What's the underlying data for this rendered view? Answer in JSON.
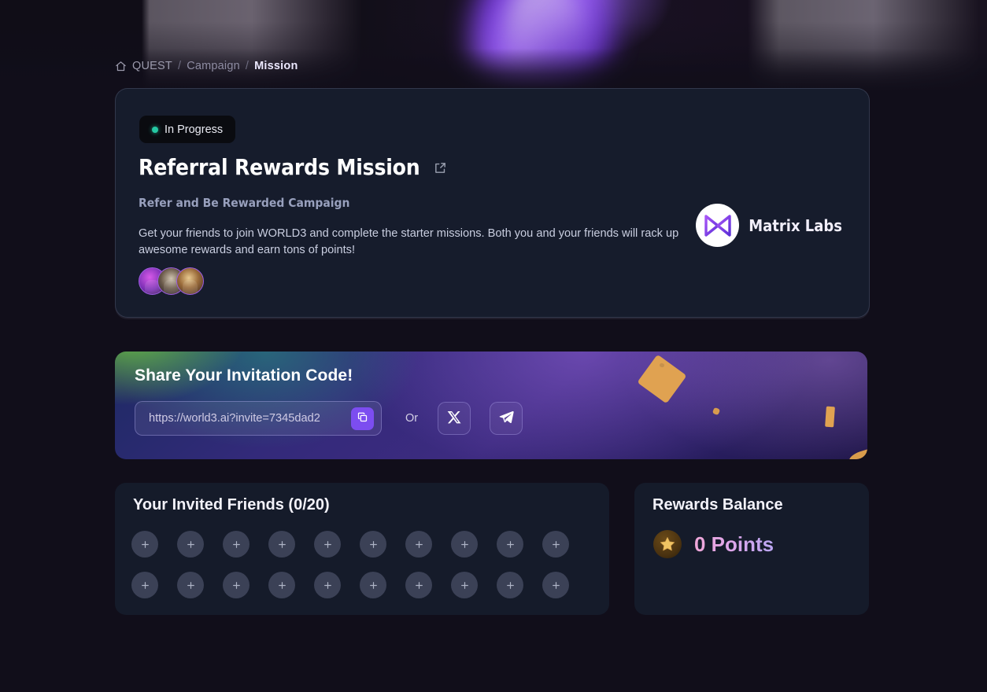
{
  "breadcrumb": {
    "home_icon": "home-icon",
    "items": [
      {
        "label": "QUEST"
      },
      {
        "label": "Campaign"
      },
      {
        "label": "Mission"
      }
    ],
    "separator": "/"
  },
  "mission": {
    "status": "In Progress",
    "title": "Referral Rewards Mission",
    "external_link_icon": "external-link-icon",
    "subtitle": "Refer and Be Rewarded Campaign",
    "description": "Get your friends to join WORLD3 and complete the starter missions. Both you and your friends will rack up awesome rewards and earn tons of points!",
    "participants_count": 3,
    "organization": {
      "name": "Matrix Labs",
      "logo_icon": "matrix-labs-logo-icon"
    }
  },
  "invite": {
    "title": "Share Your Invitation Code!",
    "url": "https://world3.ai?invite=7345dad2",
    "copy_icon": "copy-icon",
    "or_label": "Or",
    "share_twitter_icon": "x-twitter-icon",
    "share_telegram_icon": "telegram-icon"
  },
  "friends": {
    "title": "Your Invited Friends (0/20)",
    "invited": 0,
    "total": 20,
    "slot_icon": "plus-icon"
  },
  "rewards": {
    "title": "Rewards Balance",
    "star_icon": "star-icon",
    "points_label": "0 Points"
  },
  "colors": {
    "page_background": "#110e1a",
    "card_background": "#151b2a",
    "accent_purple": "#7c4df0",
    "status_green": "#25c8a3",
    "points_gradient_start": "#f0a7d8",
    "points_gradient_end": "#b9a6f2",
    "confetti_orange": "#e0a251"
  }
}
